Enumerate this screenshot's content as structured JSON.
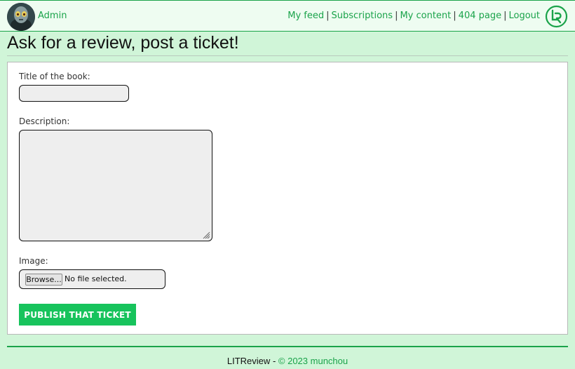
{
  "header": {
    "username": "Admin",
    "nav": [
      {
        "label": "My feed"
      },
      {
        "label": "Subscriptions"
      },
      {
        "label": "My content"
      },
      {
        "label": "404 page"
      },
      {
        "label": "Logout"
      }
    ],
    "separator": "|"
  },
  "page": {
    "title": "Ask for a review, post a ticket!"
  },
  "form": {
    "title_label": "Title of the book:",
    "title_value": "",
    "description_label": "Description:",
    "description_value": "",
    "image_label": "Image:",
    "browse_label": "Browse...",
    "file_status": "No file selected.",
    "submit_label": "PUBLISH THAT TICKET"
  },
  "footer": {
    "app_name": "LITReview",
    "dash": "-",
    "copyright": "© 2023 munchou"
  },
  "colors": {
    "accent": "#1aa34a",
    "button": "#17c35c",
    "background": "#d0f5d8"
  },
  "icons": {
    "logo": "lr-logo-icon",
    "avatar": "user-avatar"
  }
}
